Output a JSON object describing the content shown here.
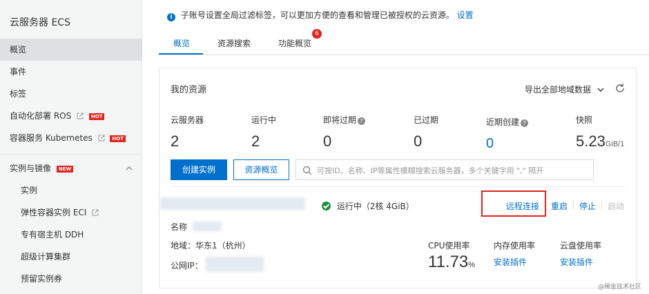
{
  "sidebar": {
    "title": "云服务器 ECS",
    "items": [
      {
        "label": "概览",
        "active": true
      },
      {
        "label": "事件"
      },
      {
        "label": "标签"
      },
      {
        "label": "自动化部署 ROS",
        "badge": "HOT"
      },
      {
        "label": "容器服务 Kubernetes",
        "badge": "HOT"
      }
    ],
    "group": {
      "label": "实例与镜像",
      "badge": "NEW"
    },
    "sub_items": [
      "实例",
      "弹性容器实例 ECI",
      "专有宿主机 DDH",
      "超级计算集群",
      "预留实例券"
    ]
  },
  "notice": {
    "text": "子账号设置全局过滤标签，可以更加方便的查看和管理已被授权的云资源。",
    "link": "设置"
  },
  "tabs": [
    {
      "label": "概览",
      "active": true
    },
    {
      "label": "资源搜索"
    },
    {
      "label": "功能概览",
      "badge": "6"
    }
  ],
  "resources": {
    "title": "我的资源",
    "export_label": "导出全部地域数据",
    "stats": [
      {
        "label": "云服务器",
        "value": "2"
      },
      {
        "label": "运行中",
        "value": "2"
      },
      {
        "label": "即将过期",
        "value": "0"
      },
      {
        "label": "已过期",
        "value": "0"
      },
      {
        "label": "近期创建",
        "value": "0"
      },
      {
        "label": "快照",
        "value": "5.23",
        "unit": "GiB/1"
      }
    ],
    "create_label": "创建实例",
    "overview_label": "资源概览",
    "search_placeholder": "可按ID、名称、IP等属性模糊搜索云服务器，多个关键字用 \",\" 隔开"
  },
  "instance": {
    "status": "运行中（2核 4GiB）",
    "actions": {
      "remote": "远程连接",
      "restart": "重启",
      "stop": "停止",
      "start": "启动"
    },
    "name_label": "名称",
    "region": "地域：华东1（杭州）",
    "ip_label": "公网IP：",
    "cpu_label": "CPU使用率",
    "cpu_value": "11.73",
    "cpu_unit": "%",
    "mem_label": "内存使用率",
    "disk_label": "云盘使用率",
    "install_label": "安装插件"
  },
  "watermark": "@稀金技术社区",
  "colors": {
    "accent": "#0070cc",
    "hot": "#e0231d",
    "success": "#1e8e3e"
  }
}
